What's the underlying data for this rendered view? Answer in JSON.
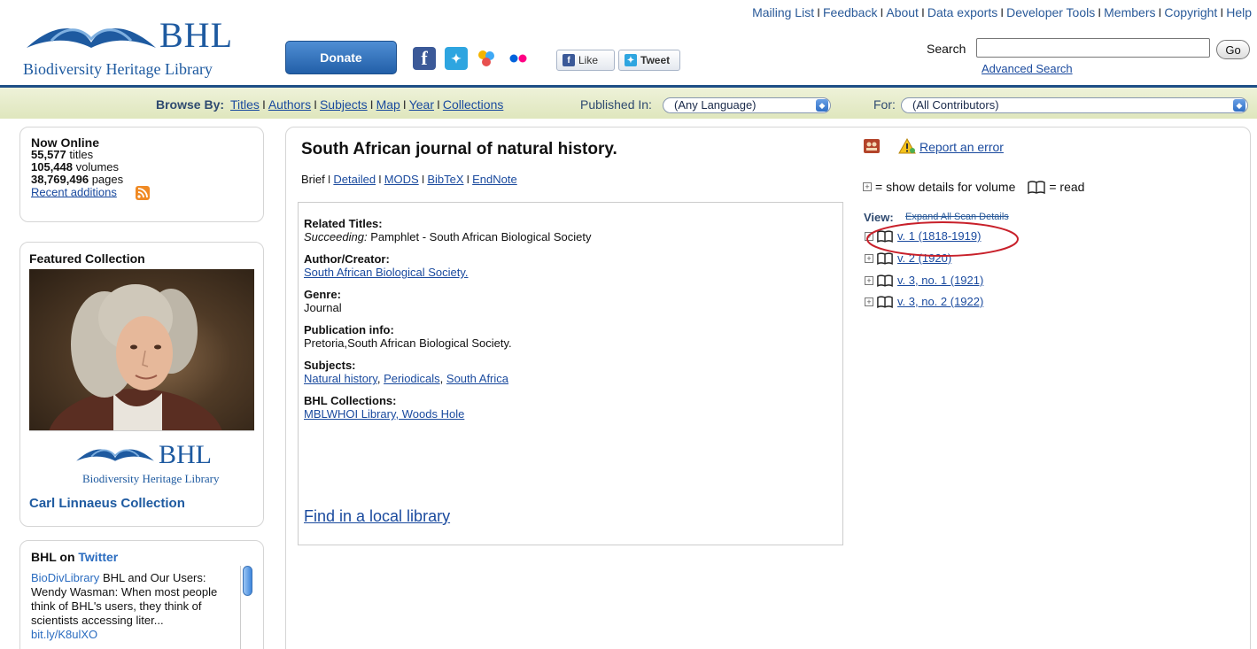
{
  "header": {
    "logo_text": "BHL",
    "logo_subtitle": "Biodiversity Heritage Library",
    "donate_label": "Donate",
    "like_label": "Like",
    "tweet_label": "Tweet",
    "top_links": [
      "Mailing List",
      "Feedback",
      "About",
      "Data exports",
      "Developer Tools",
      "Members",
      "Copyright",
      "Help"
    ],
    "search_label": "Search",
    "search_value": "",
    "go_label": "Go",
    "advanced_search": "Advanced Search"
  },
  "browse": {
    "label": "Browse By:",
    "links": [
      "Titles",
      "Authors",
      "Subjects",
      "Map",
      "Year",
      "Collections"
    ],
    "published_label": "Published In:",
    "language_value": "(Any Language)",
    "for_label": "For:",
    "contributor_value": "(All Contributors)"
  },
  "now_online": {
    "heading": "Now Online",
    "titles_count": "55,577",
    "titles_word": "titles",
    "volumes_count": "105,448",
    "volumes_word": "volumes",
    "pages_count": "38,769,496",
    "pages_word": "pages",
    "recent": "Recent additions"
  },
  "featured": {
    "heading": "Featured Collection",
    "logo_text": "BHL",
    "logo_subtitle": "Biodiversity Heritage Library",
    "link": "Carl Linnaeus Collection"
  },
  "twitter": {
    "heading_prefix": "BHL on",
    "heading_link": "Twitter",
    "user": "BioDivLibrary",
    "text": "BHL and Our Users: Wendy Wasman: When most people think of BHL's users, they think of scientists accessing liter...",
    "short_link": "bit.ly/K8ulXO"
  },
  "main": {
    "title": "South African journal of natural history.",
    "formats": [
      "Brief",
      "Detailed",
      "MODS",
      "BibTeX",
      "EndNote"
    ],
    "related_titles_label": "Related Titles:",
    "related_prefix": "Succeeding:",
    "related_value": "Pamphlet - South African Biological Society",
    "author_label": "Author/Creator:",
    "author_value": "South African Biological Society.",
    "genre_label": "Genre:",
    "genre_value": "Journal",
    "pubinfo_label": "Publication info:",
    "pubinfo_value": "Pretoria,South African Biological Society.",
    "subjects_label": "Subjects:",
    "subjects": [
      "Natural history",
      "Periodicals",
      "South Africa"
    ],
    "collections_label": "BHL Collections:",
    "collections_value": "MBLWHOI Library, Woods Hole",
    "find_local": "Find in a local library"
  },
  "right": {
    "report_error": "Report an error",
    "legend_show": "= show details for volume",
    "legend_read": "= read",
    "view_label": "View:",
    "expand_all": "Expand All Scan Details",
    "volumes": [
      "v. 1 (1818-1919)",
      "v. 2 (1920)",
      "v. 3, no. 1 (1921)",
      "v. 3, no. 2 (1922)"
    ]
  }
}
